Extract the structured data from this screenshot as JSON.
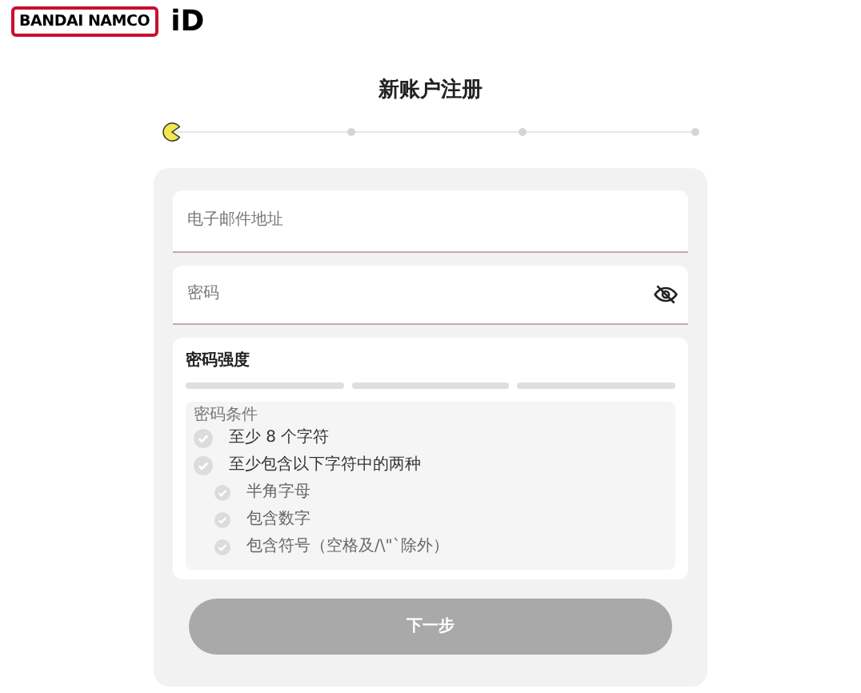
{
  "header": {
    "logo": "BANDAI NAMCO",
    "suffix": "iD"
  },
  "title": "新账户注册",
  "steps": [
    {
      "selected": true
    },
    {
      "selected": false
    },
    {
      "selected": false
    },
    {
      "selected": false
    }
  ],
  "form": {
    "email": {
      "placeholder": "电子邮件地址"
    },
    "password": {
      "placeholder": "密码",
      "visible": false
    }
  },
  "strength": {
    "title": "密码强度",
    "bars": [
      {
        "level": 0
      },
      {
        "level": 0
      },
      {
        "level": 0
      }
    ],
    "conditions_title": "密码条件",
    "conditions": [
      {
        "label": "至少 8 个字符",
        "checked": false
      },
      {
        "label": "至少包含以下字符中的两种",
        "checked": false,
        "children": [
          {
            "label": "半角字母",
            "checked": false
          },
          {
            "label": "包含数字",
            "checked": false
          },
          {
            "label": "包含符号（空格及/\\\"`除外）",
            "checked": false
          }
        ]
      }
    ]
  },
  "next_button": {
    "label": "下一步",
    "disabled": true
  }
}
